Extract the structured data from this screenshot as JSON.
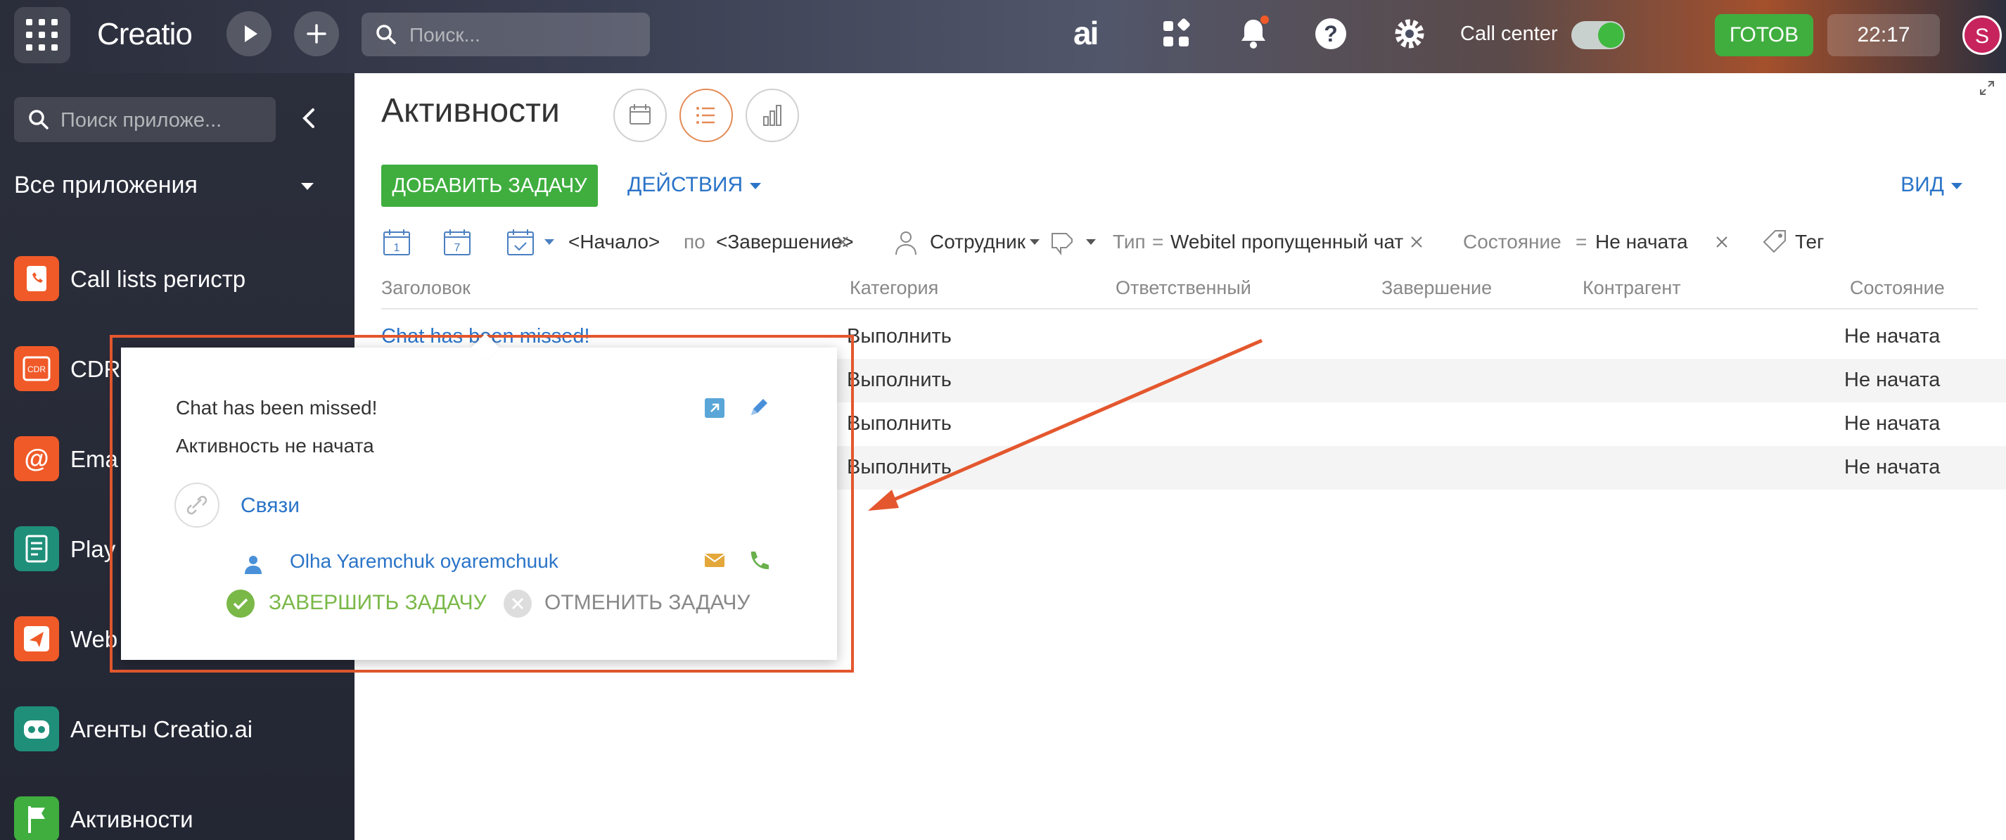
{
  "topbar": {
    "logo": "Creatio",
    "search_placeholder": "Поиск...",
    "ai_label": "ai",
    "call_center_label": "Call center",
    "ready_label": "ГОТОВ",
    "time": "22:17",
    "avatar_letter": "S"
  },
  "sidebar": {
    "search_placeholder": "Поиск приложе...",
    "all_apps_label": "Все приложения",
    "items": [
      {
        "label": "Call lists регистр",
        "color": "#f05a28"
      },
      {
        "label": "CDR",
        "color": "#f05a28"
      },
      {
        "label": "Ema",
        "color": "#f05a28"
      },
      {
        "label": "Play",
        "color": "#1f8f7a"
      },
      {
        "label": "Web",
        "color": "#f05a28"
      },
      {
        "label": "Агенты Creatio.ai",
        "color": "#1f8f7a"
      },
      {
        "label": "Активности",
        "color": "#3fae3f"
      }
    ]
  },
  "main": {
    "title": "Активности",
    "add_task_label": "ДОБАВИТЬ ЗАДАЧУ",
    "actions_label": "ДЕЙСТВИЯ",
    "view_label": "ВИД",
    "filters": {
      "calendar_day": "1",
      "calendar_week": "7",
      "period_start": "<Начало>",
      "period_by": "по",
      "period_end": "<Завершение>",
      "employee": "Сотрудник",
      "type_label": "Тип",
      "type_eq": "=",
      "type_value": "Webitel пропущенный чат",
      "state_label": "Состояние",
      "state_eq": "=",
      "state_value": "Не начата",
      "tag_label": "Тег"
    },
    "columns": [
      "Заголовок",
      "Категория",
      "Ответственный",
      "Завершение",
      "Контрагент",
      "Состояние"
    ],
    "rows": [
      {
        "title": "Chat has been missed!",
        "category": "Выполнить",
        "state": "Не начата"
      },
      {
        "title": "",
        "category": "Выполнить",
        "state": "Не начата"
      },
      {
        "title": "",
        "category": "Выполнить",
        "state": "Не начата"
      },
      {
        "title": "",
        "category": "Выполнить",
        "state": "Не начата"
      }
    ]
  },
  "popup": {
    "title": "Chat has been missed!",
    "status": "Активность не начата",
    "links_label": "Связи",
    "person": "Olha Yaremchuk oyaremchuuk",
    "complete_label": "ЗАВЕРШИТЬ ЗАДАЧУ",
    "cancel_label": "ОТМЕНИТЬ ЗАДАЧУ"
  },
  "colors": {
    "accent_green": "#3fae3f",
    "link_blue": "#2a74c8",
    "callout_red": "#e4572e"
  }
}
